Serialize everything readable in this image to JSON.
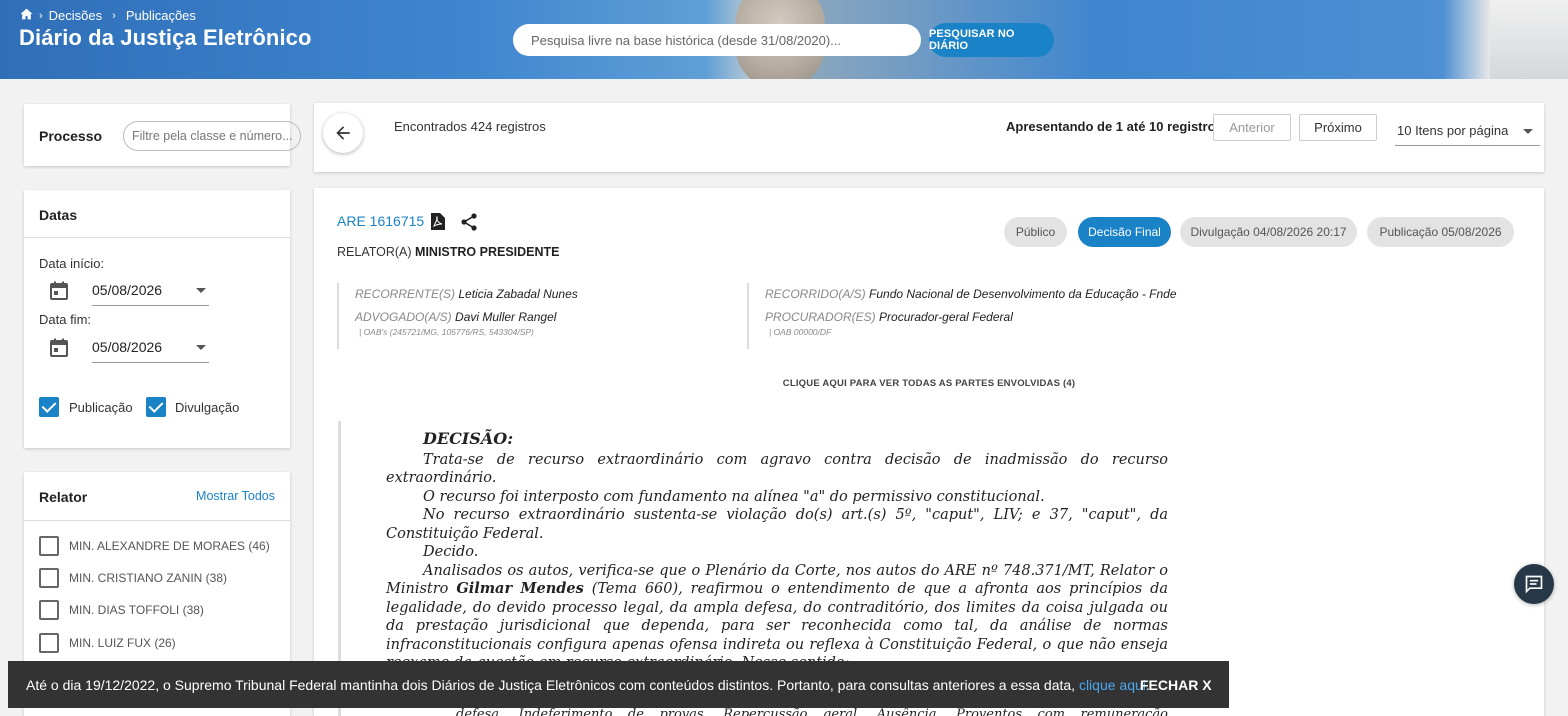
{
  "header": {
    "breadcrumb": [
      "Decisões",
      "Publicações"
    ],
    "title": "Diário da Justiça Eletrônico",
    "search_placeholder": "Pesquisa livre na base histórica (desde 31/08/2020)...",
    "search_button": "PESQUISAR NO DIÁRIO"
  },
  "sidebar": {
    "processo": {
      "label": "Processo",
      "placeholder": "Filtre pela classe e número..."
    },
    "datas": {
      "title": "Datas",
      "start_label": "Data início:",
      "start_value": "05/08/2026",
      "end_label": "Data fim:",
      "end_value": "05/08/2026",
      "checks": [
        {
          "label": "Publicação",
          "checked": true
        },
        {
          "label": "Divulgação",
          "checked": true
        }
      ]
    },
    "relator": {
      "title": "Relator",
      "show_all": "Mostrar Todos",
      "items": [
        {
          "label": "MIN. ALEXANDRE DE MORAES (46)"
        },
        {
          "label": "MIN. CRISTIANO ZANIN (38)"
        },
        {
          "label": "MIN. DIAS TOFFOLI (38)"
        },
        {
          "label": "MIN. LUIZ FUX (26)"
        }
      ]
    }
  },
  "results": {
    "found": "Encontrados 424 registros",
    "showing": "Apresentando de 1 até 10 registros",
    "prev": "Anterior",
    "next": "Próximo",
    "per_page": "10 Itens por página"
  },
  "record": {
    "case": "ARE 1616715",
    "relator_prefix": "RELATOR(A)",
    "relator_name": "MINISTRO PRESIDENTE",
    "badges": [
      "Público",
      "Decisão Final",
      "Divulgação 04/08/2026 20:17",
      "Publicação 05/08/2026"
    ],
    "parties_left": {
      "role1": "RECORRENTE(S)",
      "name1": "Leticia Zabadal Nunes",
      "role2": "ADVOGADO(A/S)",
      "name2": "Davi Muller Rangel",
      "oab": "| OAB's (245721/MG, 105776/RS, 543304/SP)"
    },
    "parties_right": {
      "role1": "RECORRIDO(A/S)",
      "name1": "Fundo Nacional de Desenvolvimento da Educação - Fnde",
      "role2": "PROCURADOR(ES)",
      "name2": "Procurador-geral Federal",
      "oab": "| OAB 00000/DF"
    },
    "all_parties": "CLIQUE AQUI PARA VER TODAS AS PARTES ENVOLVIDAS (4)",
    "decision": {
      "heading": "DECISÃO:",
      "p1": "Trata-se de recurso extraordinário com agravo contra decisão de inadmissão do recurso extraordinário.",
      "p2": "O recurso foi interposto com fundamento na alínea \"a\" do permissivo constitucional.",
      "p3": "No recurso extraordinário sustenta-se violação do(s) art.(s) 5º, \"caput\", LIV; e 37, \"caput\", da Constituição Federal.",
      "p4": "Decido.",
      "p5a": "Analisados os autos, verifica-se que o Plenário da Corte, nos autos do ARE nº 748.371/MT, Relator o Ministro",
      "p5b": "Gilmar Mendes",
      "p5c": "(Tema 660), reafirmou o entendimento de que a afronta aos princípios da legalidade, do devido processo legal, da ampla defesa, do contraditório, dos limites da coisa julgada ou da prestação jurisdicional que dependa, para ser reconhecida como tal, da análise de normas infraconstitucionais configura apenas ofensa indireta ou reflexa à Constituição Federal, o que não enseja reexame da questão em recurso extraordinário. Nesse sentido:",
      "p6": "defesa. Indeferimento de provas. Repercussão geral. Ausência. Proventos com remuneração correspondente"
    }
  },
  "banner": {
    "text": "Até o dia 19/12/2022, o Supremo Tribunal Federal mantinha dois Diários de Justiça Eletrônicos com conteúdos distintos. Portanto, para consultas anteriores a essa data,",
    "link": "clique aqui",
    "close": "FECHAR X"
  }
}
